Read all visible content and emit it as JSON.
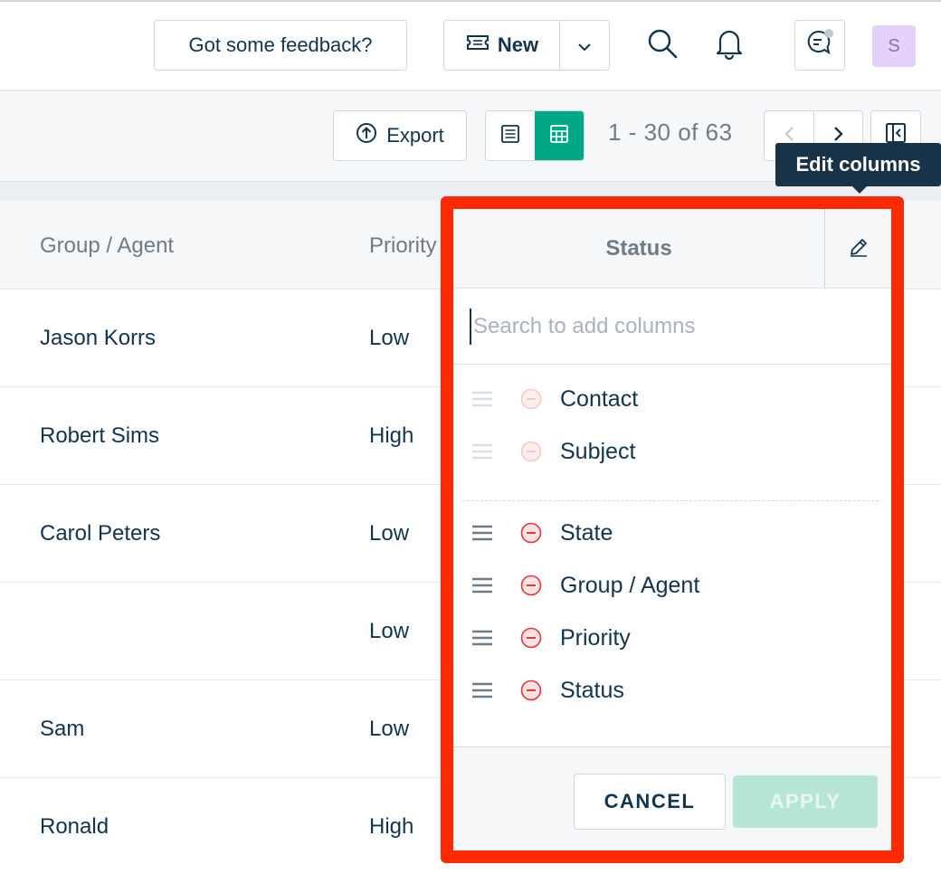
{
  "header": {
    "feedback_label": "Got some feedback?",
    "new_label": "New",
    "avatar_initial": "S"
  },
  "toolbar": {
    "export_label": "Export",
    "pager_text": "1 - 30 of 63"
  },
  "table": {
    "headers": {
      "agent": "Group / Agent",
      "priority": "Priority"
    },
    "rows": [
      {
        "agent": "Jason Korrs",
        "priority": "Low"
      },
      {
        "agent": "Robert Sims",
        "priority": "High"
      },
      {
        "agent": "Carol Peters",
        "priority": "Low"
      },
      {
        "agent": "",
        "priority": "Low"
      },
      {
        "agent": "Sam",
        "priority": "Low"
      },
      {
        "agent": "Ronald",
        "priority": "High"
      }
    ]
  },
  "tooltip": {
    "text": "Edit columns"
  },
  "panel": {
    "header_label": "Status",
    "search_placeholder": "Search to add columns",
    "fixed_columns": [
      "Contact",
      "Subject"
    ],
    "selected_columns": [
      "State",
      "Group / Agent",
      "Priority",
      "Status"
    ],
    "cancel_label": "CANCEL",
    "apply_label": "APPLY"
  },
  "colors": {
    "accent_green": "#00a886",
    "highlight_red": "#ff2a00",
    "remove_red": "#e43538",
    "avatar_bg": "#e5d2fb"
  },
  "icons": {
    "new": "ticket-icon",
    "search": "search-icon",
    "bell": "bell-icon",
    "chat": "chat-icon",
    "export": "export-icon",
    "list_view": "list-view-icon",
    "table_view": "table-view-icon",
    "edit": "pencil-icon",
    "drag": "drag-handle-icon",
    "remove": "remove-circle-icon"
  }
}
